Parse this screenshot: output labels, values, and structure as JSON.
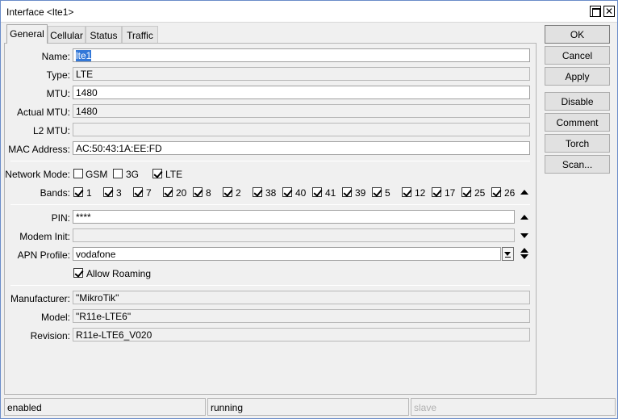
{
  "window": {
    "title": "Interface <lte1>"
  },
  "tabs": [
    {
      "label": "General",
      "active": true
    },
    {
      "label": "Cellular"
    },
    {
      "label": "Status"
    },
    {
      "label": "Traffic"
    }
  ],
  "general": {
    "name": {
      "label": "Name:",
      "value": "lte1"
    },
    "type": {
      "label": "Type:",
      "value": "LTE"
    },
    "mtu": {
      "label": "MTU:",
      "value": "1480"
    },
    "actual_mtu": {
      "label": "Actual MTU:",
      "value": "1480"
    },
    "l2_mtu": {
      "label": "L2 MTU:",
      "value": ""
    },
    "mac": {
      "label": "MAC Address:",
      "value": "AC:50:43:1A:EE:FD"
    }
  },
  "network_mode": {
    "label": "Network Mode:",
    "options": [
      {
        "label": "GSM",
        "checked": false
      },
      {
        "label": "3G",
        "checked": false
      },
      {
        "label": "LTE",
        "checked": true
      }
    ]
  },
  "bands": {
    "label": "Bands:",
    "items": [
      "1",
      "3",
      "7",
      "20",
      "8",
      "2",
      "38",
      "40",
      "41",
      "39",
      "5",
      "12",
      "17",
      "25",
      "26"
    ]
  },
  "cellular": {
    "pin": {
      "label": "PIN:",
      "value": "****"
    },
    "modem_init": {
      "label": "Modem Init:",
      "value": ""
    },
    "apn_profile": {
      "label": "APN Profile:",
      "value": "vodafone"
    },
    "allow_roaming": {
      "label": "Allow Roaming",
      "checked": true
    }
  },
  "device": {
    "manufacturer": {
      "label": "Manufacturer:",
      "value": "\"MikroTik\""
    },
    "model": {
      "label": "Model:",
      "value": "\"R11e-LTE6\""
    },
    "revision": {
      "label": "Revision:",
      "value": "R11e-LTE6_V020"
    }
  },
  "buttons": {
    "ok": "OK",
    "cancel": "Cancel",
    "apply": "Apply",
    "disable": "Disable",
    "comment": "Comment",
    "torch": "Torch",
    "scan": "Scan..."
  },
  "status": {
    "state": "enabled",
    "running": "running",
    "slave": "slave"
  },
  "icons": {
    "maximize": "maximize-icon",
    "close": "close-icon",
    "up": "triangle-up-icon",
    "down": "triangle-down-icon",
    "updown": "up-down-icon"
  },
  "colors": {
    "selection": "#3378d8",
    "window_border": "#6a8cc9"
  }
}
